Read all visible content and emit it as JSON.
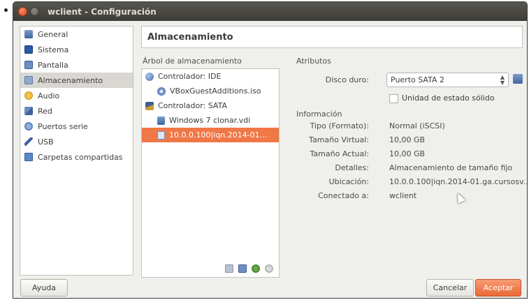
{
  "window": {
    "title": "wclient - Configuración"
  },
  "sidebar": {
    "items": [
      {
        "label": "General",
        "icon": "general-icon"
      },
      {
        "label": "Sistema",
        "icon": "system-icon"
      },
      {
        "label": "Pantalla",
        "icon": "display-icon"
      },
      {
        "label": "Almacenamiento",
        "icon": "storage-icon",
        "selected": true
      },
      {
        "label": "Audio",
        "icon": "audio-icon"
      },
      {
        "label": "Red",
        "icon": "network-icon"
      },
      {
        "label": "Puertos serie",
        "icon": "serial-ports-icon"
      },
      {
        "label": "USB",
        "icon": "usb-icon"
      },
      {
        "label": "Carpetas compartidas",
        "icon": "shared-folders-icon"
      }
    ]
  },
  "header": {
    "title": "Almacenamiento"
  },
  "storage_tree": {
    "label": "Árbol de almacenamiento",
    "items": [
      {
        "label": "Controlador: IDE",
        "level": 0
      },
      {
        "label": "VBoxGuestAdditions.iso",
        "level": 1
      },
      {
        "label": "Controlador: SATA",
        "level": 0
      },
      {
        "label": "Windows 7 clonar.vdi",
        "level": 1
      },
      {
        "label": "10.0.0.100|iqn.2014-01...",
        "level": 1,
        "selected": true
      }
    ]
  },
  "attributes": {
    "label": "Atributos",
    "hard_disk_label": "Disco duro:",
    "hard_disk_value": "Puerto SATA 2",
    "ssd_label": "Unidad de estado sólido",
    "ssd_checked": false
  },
  "information": {
    "label": "Información",
    "rows": [
      {
        "key": "Tipo (Formato):",
        "value": "Normal (iSCSI)"
      },
      {
        "key": "Tamaño Virtual:",
        "value": "10,00 GB"
      },
      {
        "key": "Tamaño Actual:",
        "value": "10,00 GB"
      },
      {
        "key": "Detalles:",
        "value": "Almacenamiento de tamaño fijo"
      },
      {
        "key": "Ubicación:",
        "value": "10.0.0.100|iqn.2014-01.ga.cursosv..."
      },
      {
        "key": "Conectado a:",
        "value": "wclient"
      }
    ]
  },
  "buttons": {
    "help": "Ayuda",
    "cancel": "Cancelar",
    "accept": "Aceptar"
  },
  "colors": {
    "accent": "#f07746",
    "titlebar": "#3d3c38",
    "background": "#efefec"
  }
}
